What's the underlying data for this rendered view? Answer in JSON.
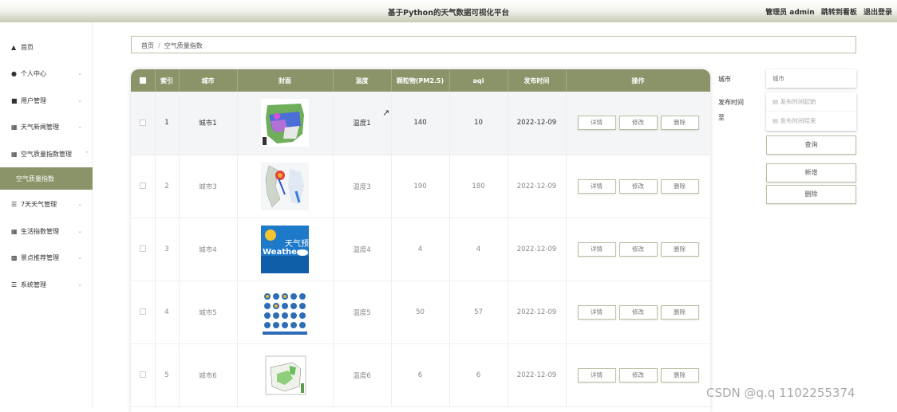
{
  "header": {
    "title": "基于Python的天气数据可视化平台",
    "role": "管理员 admin",
    "to_board": "跳转到看板",
    "logout": "退出登录"
  },
  "sidebar": {
    "items": [
      {
        "label": "首页",
        "icon": "home-icon"
      },
      {
        "label": "个人中心",
        "icon": "user-icon"
      },
      {
        "label": "用户管理",
        "icon": "users-icon"
      },
      {
        "label": "天气新闻管理",
        "icon": "grid-icon"
      },
      {
        "label": "空气质量指数管理",
        "icon": "grid-icon"
      },
      {
        "label": "空气质量指数",
        "icon": ""
      },
      {
        "label": "7天天气管理",
        "icon": "list-icon"
      },
      {
        "label": "生活指数管理",
        "icon": "grid-icon"
      },
      {
        "label": "景点推荐管理",
        "icon": "chart-icon"
      },
      {
        "label": "系统管理",
        "icon": "list-icon"
      }
    ]
  },
  "breadcrumb": {
    "home": "首页",
    "sep": "/",
    "current": "空气质量指数"
  },
  "table": {
    "headers": [
      "索引",
      "城市",
      "封面",
      "温度",
      "颗粒物(PM2.5)",
      "aqi",
      "发布时间",
      "操作"
    ],
    "actions": {
      "detail": "详情",
      "edit": "修改",
      "delete": "删除"
    },
    "rows": [
      {
        "index": "1",
        "city": "城市1",
        "temp": "温度1",
        "pm25": "140",
        "aqi": "10",
        "date": "2022-12-09",
        "cover": "weather-map-cover"
      },
      {
        "index": "2",
        "city": "城市3",
        "temp": "温度3",
        "pm25": "190",
        "aqi": "180",
        "date": "2022-12-09",
        "cover": "typhoon-map-cover"
      },
      {
        "index": "3",
        "city": "城市4",
        "temp": "温度4",
        "pm25": "4",
        "aqi": "4",
        "date": "2022-12-09",
        "cover": "weather-forecast-cover"
      },
      {
        "index": "4",
        "city": "城市5",
        "temp": "温度5",
        "pm25": "50",
        "aqi": "57",
        "date": "2022-12-09",
        "cover": "weather-icons-cover"
      },
      {
        "index": "5",
        "city": "城市6",
        "temp": "温度6",
        "pm25": "6",
        "aqi": "6",
        "date": "2022-12-09",
        "cover": "precipitation-map-cover"
      }
    ],
    "cover3_text1": "天气预报",
    "cover3_text2": "Weather"
  },
  "filter": {
    "city_label": "城市",
    "city_placeholder": "城市",
    "time_label": "发布时间",
    "to_label": "至",
    "start_placeholder": "发布时间起始",
    "end_placeholder": "发布时间结束",
    "query": "查询",
    "add": "新增",
    "delete": "删除"
  },
  "watermark": "CSDN @q.q 1102255374",
  "colors": {
    "accent": "#8a9468",
    "border": "#b9c0a3"
  }
}
